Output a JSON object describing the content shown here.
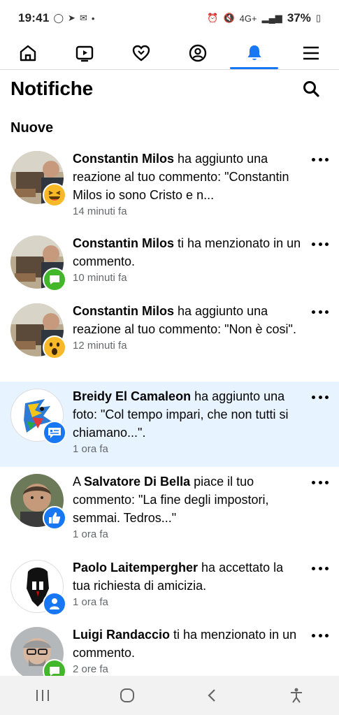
{
  "status_bar": {
    "time": "19:41",
    "battery": "37%",
    "network": "4G+"
  },
  "nav": {
    "tabs": [
      {
        "name": "home",
        "icon": "home-icon"
      },
      {
        "name": "video",
        "icon": "video-icon"
      },
      {
        "name": "dating",
        "icon": "heart-icon"
      },
      {
        "name": "profile",
        "icon": "profile-icon"
      },
      {
        "name": "notifications",
        "icon": "bell-icon",
        "active": true
      },
      {
        "name": "menu",
        "icon": "menu-icon"
      }
    ],
    "accent": "#1877f2"
  },
  "header": {
    "title": "Notifiche"
  },
  "section": {
    "title": "Nuove"
  },
  "notifications": [
    {
      "actor": "Constantin Milos",
      "text": " ha aggiunto una reazione al tuo commento: \"Constantin Milos io sono Cristo e n...",
      "time": "14 minuti fa",
      "badge": "haha-reaction-icon"
    },
    {
      "actor": "Constantin Milos",
      "text": " ti ha menzionato in un commento.",
      "time": "10 minuti fa",
      "badge": "comment-icon"
    },
    {
      "actor": "Constantin Milos",
      "text": " ha aggiunto una reazione al tuo commento: \"Non è cosi\".",
      "time": "12 minuti fa",
      "badge": "wow-reaction-icon"
    },
    {
      "actor": "Breidy El Camaleon",
      "text": " ha aggiunto una foto: \"Col tempo impari, che non tutti si chiamano...\".",
      "time": "1 ora fa",
      "badge": "page-post-icon",
      "highlight": true
    },
    {
      "prefix": "A ",
      "actor": "Salvatore Di Bella",
      "text": " piace il tuo commento: \"La fine degli impostori, semmai. Tedros...\"",
      "time": "1 ora fa",
      "badge": "like-icon"
    },
    {
      "actor": "Paolo Laitempergher",
      "text": " ha accettato la tua richiesta di amicizia.",
      "time": "1 ora fa",
      "badge": "friend-icon"
    },
    {
      "actor": "Luigi Randaccio",
      "text": " ti ha menzionato in un commento.",
      "time": "2 ore fa",
      "badge": "comment-icon"
    }
  ]
}
